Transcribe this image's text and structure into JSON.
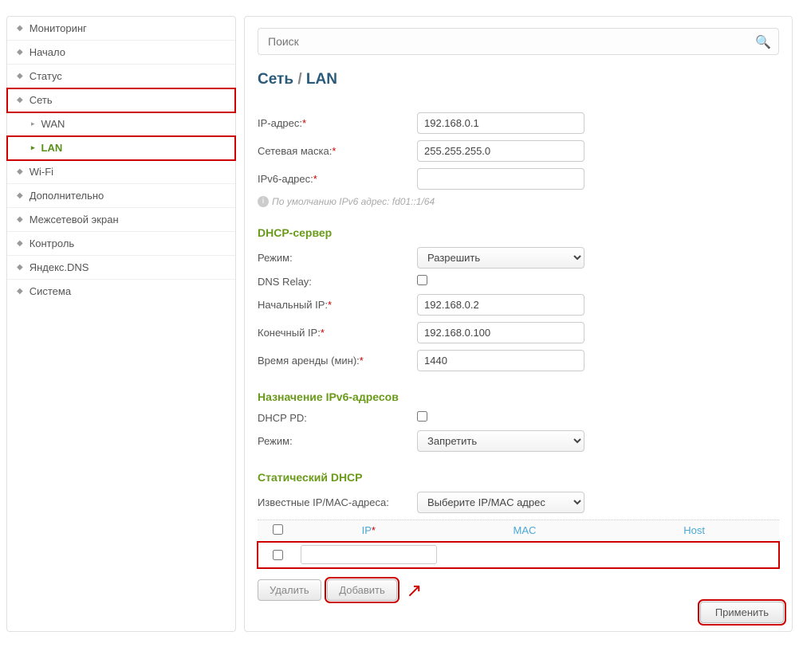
{
  "search": {
    "placeholder": "Поиск"
  },
  "nav": {
    "monitoring": "Мониторинг",
    "start": "Начало",
    "status": "Статус",
    "network": "Сеть",
    "wan": "WAN",
    "lan": "LAN",
    "wifi": "Wi-Fi",
    "advanced": "Дополнительно",
    "firewall": "Межсетевой экран",
    "control": "Контроль",
    "yandex": "Яндекс.DNS",
    "system": "Система"
  },
  "bc": {
    "a": "Сеть",
    "sep": "/",
    "b": "LAN"
  },
  "fields": {
    "ip_label": "IP-адрес:",
    "ip_value": "192.168.0.1",
    "mask_label": "Сетевая маска:",
    "mask_value": "255.255.255.0",
    "ipv6_label": "IPv6-адрес:",
    "ipv6_value": "",
    "hint": "По умолчанию IPv6 адрес: fd01::1/64"
  },
  "dhcp": {
    "title": "DHCP-сервер",
    "mode_label": "Режим:",
    "mode_value": "Разрешить",
    "relay_label": "DNS Relay:",
    "start_label": "Начальный IP:",
    "start_value": "192.168.0.2",
    "end_label": "Конечный IP:",
    "end_value": "192.168.0.100",
    "lease_label": "Время аренды (мин):",
    "lease_value": "1440"
  },
  "ipv6": {
    "title": "Назначение IPv6-адресов",
    "pd_label": "DHCP PD:",
    "mode_label": "Режим:",
    "mode_value": "Запретить"
  },
  "static": {
    "title": "Статический DHCP",
    "known_label": "Известные IP/MAC-адреса:",
    "known_value": "Выберите IP/MAC адрес",
    "col_ip": "IP",
    "col_mac": "MAC",
    "col_host": "Host",
    "delete": "Удалить",
    "add": "Добавить"
  },
  "apply": "Применить"
}
